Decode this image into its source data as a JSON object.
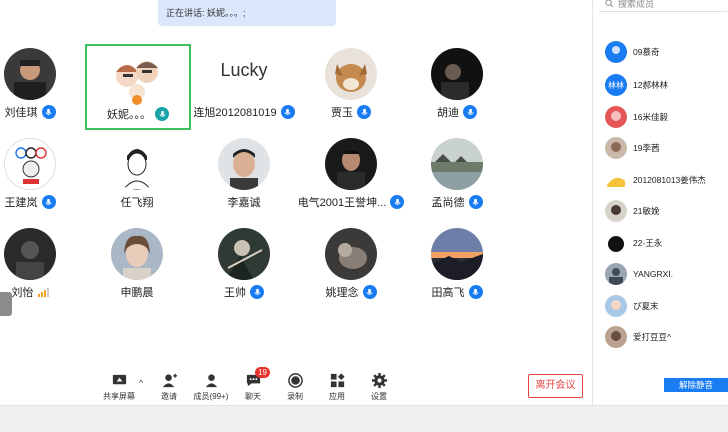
{
  "banner": {
    "speaking": "正在讲话: 妖妮。。。;"
  },
  "participants": [
    {
      "name": "刘佳琪",
      "mic": true
    },
    {
      "name": "妖妮。。。",
      "mic": true,
      "active": true
    },
    {
      "name": "连旭2012081019",
      "mic": true,
      "video_name": "Lucky"
    },
    {
      "name": "贾玉",
      "mic": true
    },
    {
      "name": "胡迪",
      "mic": true
    },
    {
      "name": "王建岚",
      "mic": true
    },
    {
      "name": "任飞翔",
      "mic": false
    },
    {
      "name": "李嘉诚",
      "mic": false
    },
    {
      "name": "电气2001王誉坤...",
      "mic": true
    },
    {
      "name": "孟尚德",
      "mic": true
    },
    {
      "name": "刘怡",
      "mic": false,
      "signal": true
    },
    {
      "name": "申鹏晨",
      "mic": false
    },
    {
      "name": "王帅",
      "mic": true
    },
    {
      "name": "姚理念",
      "mic": true
    },
    {
      "name": "田高飞",
      "mic": true
    }
  ],
  "toolbar": {
    "share": "共享屏幕",
    "invite": "邀请",
    "members": "成员(99+)",
    "chat": "聊天",
    "chat_badge": "19",
    "record": "录制",
    "apps": "应用",
    "settings": "设置",
    "leave": "离开会议"
  },
  "panel": {
    "search_placeholder": "搜索成员",
    "members": [
      {
        "name": "09慕奇",
        "initials": ""
      },
      {
        "name": "12郝林林",
        "initials": "林林"
      },
      {
        "name": "16米佳毅",
        "initials": ""
      },
      {
        "name": "19李茜",
        "initials": ""
      },
      {
        "name": "2012081013姜伟杰",
        "initials": ""
      },
      {
        "name": "21敏娩",
        "initials": ""
      },
      {
        "name": "22-王永",
        "initials": ""
      },
      {
        "name": "YANGRXI.",
        "initials": ""
      },
      {
        "name": "ぴ夏末",
        "initials": ""
      },
      {
        "name": "爱打豆豆^",
        "initials": ""
      }
    ],
    "unmute_label": "解除静音"
  },
  "colors": {
    "accent": "#1a7cf2",
    "active_border": "#3fc15e",
    "danger": "#e64545"
  }
}
